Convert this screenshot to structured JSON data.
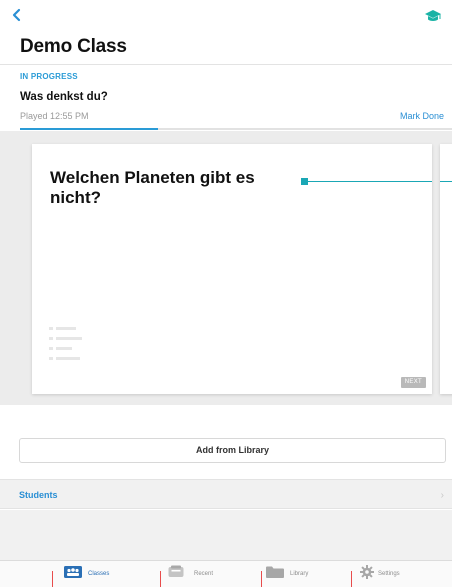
{
  "header": {
    "title": "Demo Class",
    "back_icon": "chevron-left-icon",
    "cap_icon": "graduation-cap-icon"
  },
  "session": {
    "status": "IN PROGRESS",
    "game_title": "Was denkst du?",
    "played": "Played 12:55 PM",
    "mark_done": "Mark Done",
    "progress": 0.32
  },
  "card": {
    "question": "Welchen Planeten gibt es nicht?",
    "next_label": "NEXT"
  },
  "actions": {
    "add_from_library": "Add from Library"
  },
  "students": {
    "label": "Students",
    "chevron": "›"
  },
  "tabs": [
    {
      "label": "Classes",
      "icon": "classes-icon",
      "active": true
    },
    {
      "label": "Recent",
      "icon": "recent-icon",
      "active": false
    },
    {
      "label": "Library",
      "icon": "folder-icon",
      "active": false
    },
    {
      "label": "Settings",
      "icon": "gear-icon",
      "active": false
    }
  ],
  "colors": {
    "accent": "#2a9bd6",
    "link": "#2a8fd4",
    "teal": "#1aa7b5",
    "cap": "#1bb3a6",
    "annotation": "#e84c4c"
  }
}
